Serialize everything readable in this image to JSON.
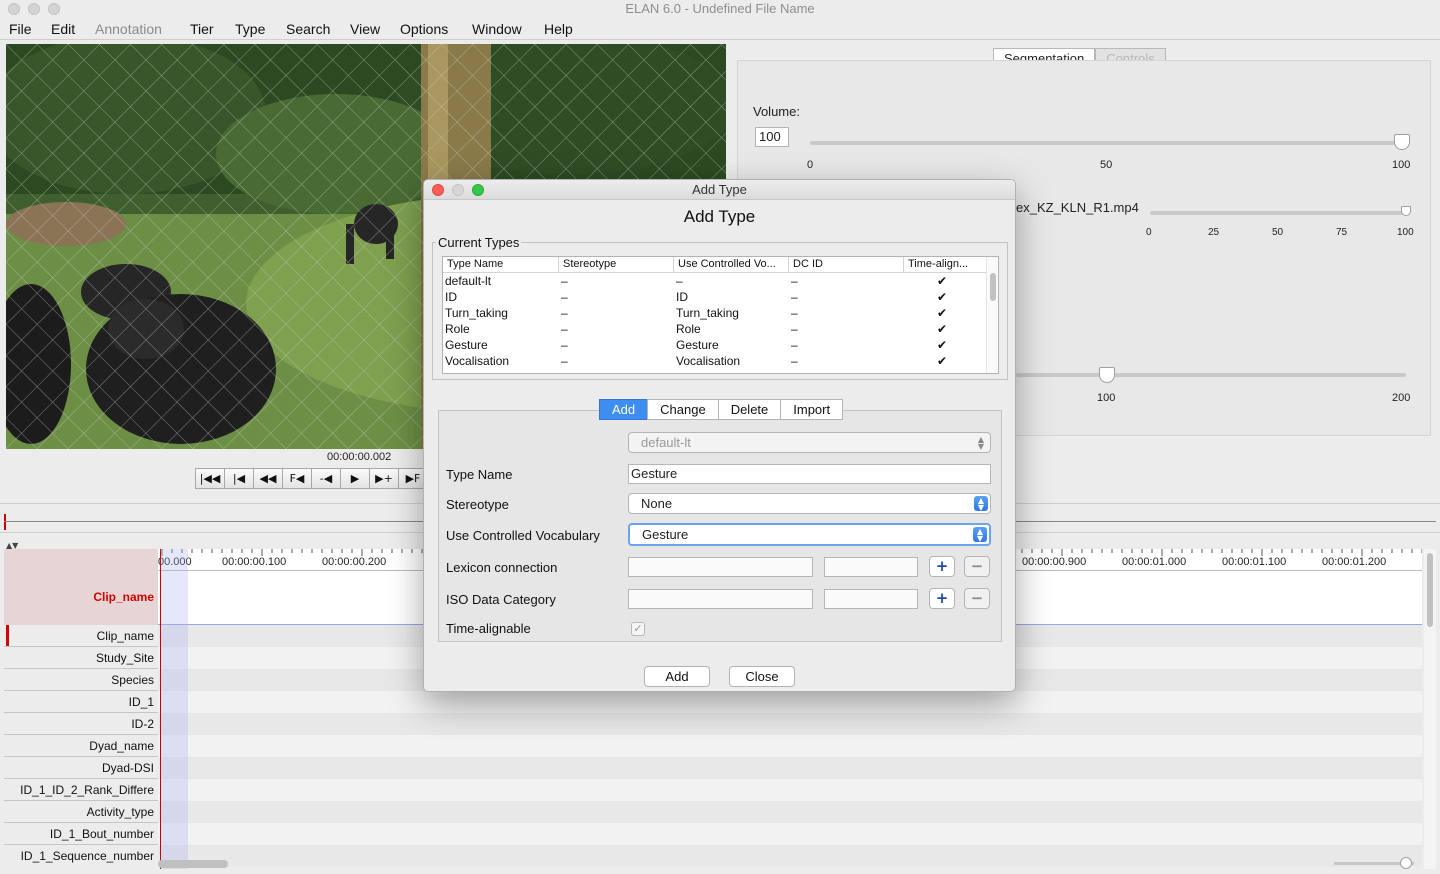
{
  "window": {
    "title": "ELAN 6.0 - Undefined File Name"
  },
  "menu": [
    "File",
    "Edit",
    "Annotation",
    "Tier",
    "Type",
    "Search",
    "View",
    "Options",
    "Window",
    "Help"
  ],
  "media": {
    "timecode": "00:00:00.002"
  },
  "right_panel": {
    "tabs": [
      "Segmentation",
      "Controls"
    ],
    "volume_label": "Volume:",
    "volume_value": "100",
    "volume_ticks": [
      "0",
      "50",
      "100"
    ],
    "file_label": "ex_KZ_KLN_R1.mp4",
    "file_ticks": [
      "0",
      "25",
      "50",
      "75",
      "100"
    ],
    "rate_ticks": [
      "100",
      "200"
    ]
  },
  "timeline": {
    "active_tier": "Clip_name",
    "ruler": [
      "00.000",
      "00:00:00.100",
      "00:00:00.200",
      "00:00:00.900",
      "00:00:01.000",
      "00:00:01.100",
      "00:00:01.200"
    ],
    "tiers": [
      "Clip_name",
      "Study_Site",
      "Species",
      "ID_1",
      "ID-2",
      "Dyad_name",
      "Dyad-DSI",
      "ID_1_ID_2_Rank_Differe",
      "Activity_type",
      "ID_1_Bout_number",
      "ID_1_Sequence_number"
    ]
  },
  "dialog": {
    "title": "Add Type",
    "heading": "Add Type",
    "group_title": "Current Types",
    "columns": [
      "Type Name",
      "Stereotype",
      "Use Controlled Vo...",
      "DC ID",
      "Time-align..."
    ],
    "rows": [
      [
        "default-lt",
        "–",
        "–",
        "–",
        "✔"
      ],
      [
        "ID",
        "–",
        "ID",
        "–",
        "✔"
      ],
      [
        "Turn_taking",
        "–",
        "Turn_taking",
        "–",
        "✔"
      ],
      [
        "Role",
        "–",
        "Role",
        "–",
        "✔"
      ],
      [
        "Gesture",
        "–",
        "Gesture",
        "–",
        "✔"
      ],
      [
        "Vocalisation",
        "–",
        "Vocalisation",
        "–",
        "✔"
      ]
    ],
    "modes": [
      "Add",
      "Change",
      "Delete",
      "Import"
    ],
    "type_select": "default-lt",
    "labels": {
      "type_name": "Type Name",
      "stereotype": "Stereotype",
      "cv": "Use Controlled Vocabulary",
      "lexicon": "Lexicon connection",
      "iso": "ISO Data Category",
      "time_alignable": "Time-alignable"
    },
    "values": {
      "type_name": "Gesture",
      "stereotype": "None",
      "cv": "Gesture"
    },
    "buttons": {
      "add": "Add",
      "close": "Close"
    }
  }
}
